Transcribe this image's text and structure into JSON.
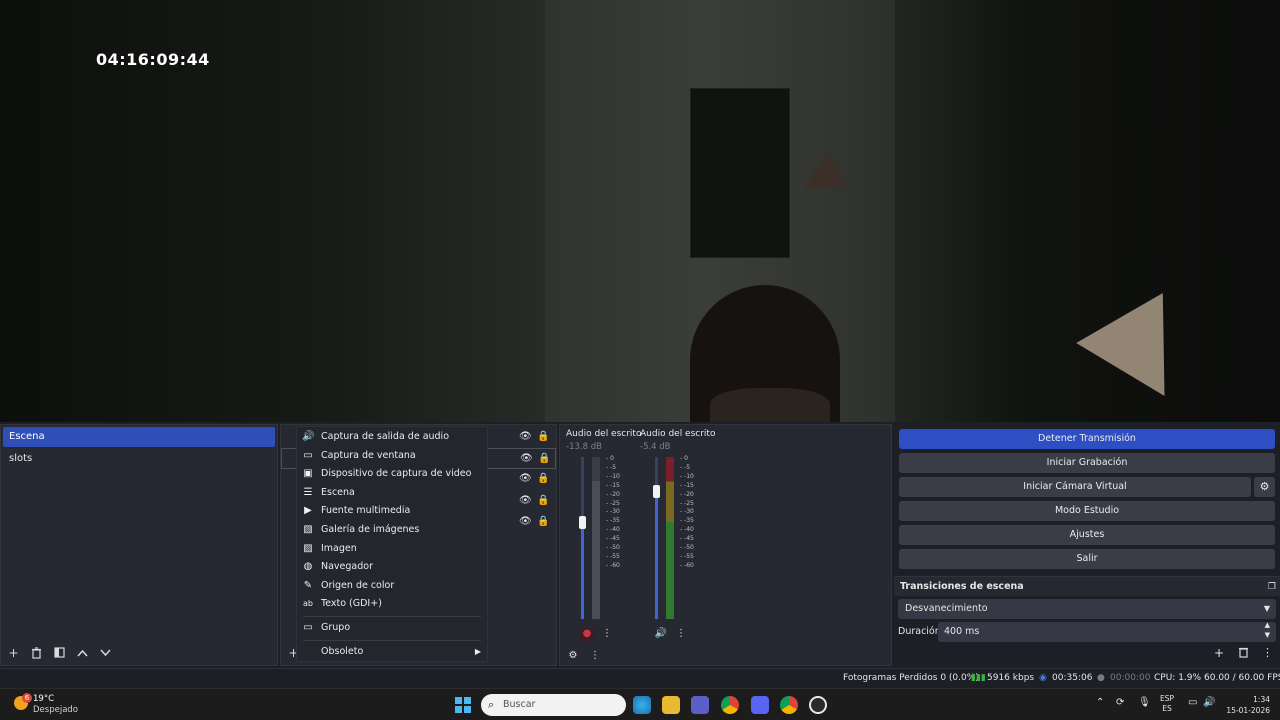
{
  "preview": {
    "overlay_time": "04:16:09:44"
  },
  "scenes": {
    "items": [
      "Escena",
      "slots"
    ],
    "selected": 0
  },
  "context_menu": {
    "items": [
      {
        "label": "Captura de salida de audio",
        "icon": "speaker-icon"
      },
      {
        "label": "Captura de ventana",
        "icon": "window-capture-icon"
      },
      {
        "label": "Dispositivo de captura de video",
        "icon": "camera-icon"
      },
      {
        "label": "Escena",
        "icon": "scene-icon"
      },
      {
        "label": "Fuente multimedia",
        "icon": "play-icon"
      },
      {
        "label": "Galería de imágenes",
        "icon": "gallery-icon"
      },
      {
        "label": "Imagen",
        "icon": "image-icon"
      },
      {
        "label": "Navegador",
        "icon": "globe-icon"
      },
      {
        "label": "Origen de color",
        "icon": "brush-icon"
      },
      {
        "label": "Texto (GDI+)",
        "icon": "text-icon"
      }
    ],
    "group": "Grupo",
    "obsolete": "Obsoleto"
  },
  "mixer": {
    "channels": [
      {
        "name": "Audio del escrito",
        "db": "-13.8 dB",
        "fader_level": 0.6,
        "muted": true
      },
      {
        "name": "Audio del escrito",
        "db": "-5.4 dB",
        "fader_level": 0.79,
        "muted": false
      }
    ],
    "ticks": [
      "0",
      "-5",
      "-10",
      "-15",
      "-20",
      "-25",
      "-30",
      "-35",
      "-40",
      "-45",
      "-50",
      "-55",
      "-60"
    ]
  },
  "controls": {
    "stop_stream": "Detener Transmisión",
    "start_recording": "Iniciar Grabación",
    "start_virtual_cam": "Iniciar Cámara Virtual",
    "studio_mode": "Modo Estudio",
    "settings": "Ajustes",
    "exit": "Salir",
    "transitions_title": "Transiciones de escena",
    "transition": "Desvanecimiento",
    "duration_label": "Duración",
    "duration_value": "400 ms"
  },
  "status": {
    "dropped_frames": "Fotogramas Perdidos 0 (0.0%)",
    "bitrate": "5916 kbps",
    "stream_time": "00:35:06",
    "record_time": "00:00:00",
    "cpu": "CPU: 1.9%",
    "fps": "60.00 / 60.00 FPS"
  },
  "taskbar": {
    "weather_badge": "6",
    "temperature": "19°C",
    "weather": "Despejado",
    "search_placeholder": "Buscar",
    "lang_top": "ESP",
    "lang_bottom": "ES",
    "time": "1:34",
    "date": "15-01-2026"
  },
  "colors": {
    "accent": "#2e4ec3",
    "panel": "#262932",
    "background": "#1d1f26"
  }
}
